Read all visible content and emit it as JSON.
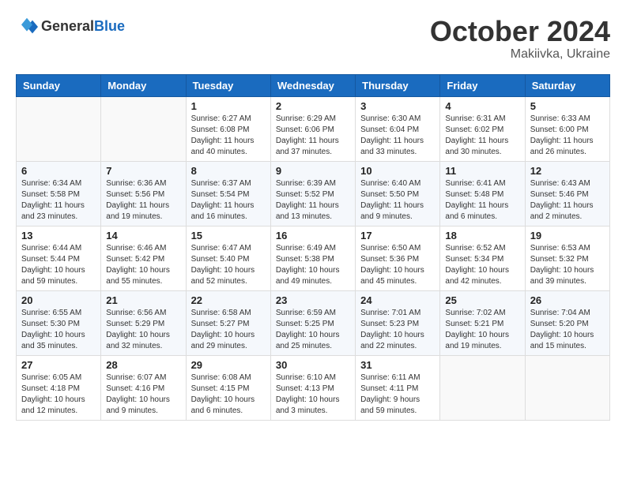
{
  "header": {
    "logo_general": "General",
    "logo_blue": "Blue",
    "month_title": "October 2024",
    "location": "Makiivka, Ukraine"
  },
  "columns": [
    "Sunday",
    "Monday",
    "Tuesday",
    "Wednesday",
    "Thursday",
    "Friday",
    "Saturday"
  ],
  "weeks": [
    [
      {
        "day": "",
        "content": ""
      },
      {
        "day": "",
        "content": ""
      },
      {
        "day": "1",
        "content": "Sunrise: 6:27 AM\nSunset: 6:08 PM\nDaylight: 11 hours and 40 minutes."
      },
      {
        "day": "2",
        "content": "Sunrise: 6:29 AM\nSunset: 6:06 PM\nDaylight: 11 hours and 37 minutes."
      },
      {
        "day": "3",
        "content": "Sunrise: 6:30 AM\nSunset: 6:04 PM\nDaylight: 11 hours and 33 minutes."
      },
      {
        "day": "4",
        "content": "Sunrise: 6:31 AM\nSunset: 6:02 PM\nDaylight: 11 hours and 30 minutes."
      },
      {
        "day": "5",
        "content": "Sunrise: 6:33 AM\nSunset: 6:00 PM\nDaylight: 11 hours and 26 minutes."
      }
    ],
    [
      {
        "day": "6",
        "content": "Sunrise: 6:34 AM\nSunset: 5:58 PM\nDaylight: 11 hours and 23 minutes."
      },
      {
        "day": "7",
        "content": "Sunrise: 6:36 AM\nSunset: 5:56 PM\nDaylight: 11 hours and 19 minutes."
      },
      {
        "day": "8",
        "content": "Sunrise: 6:37 AM\nSunset: 5:54 PM\nDaylight: 11 hours and 16 minutes."
      },
      {
        "day": "9",
        "content": "Sunrise: 6:39 AM\nSunset: 5:52 PM\nDaylight: 11 hours and 13 minutes."
      },
      {
        "day": "10",
        "content": "Sunrise: 6:40 AM\nSunset: 5:50 PM\nDaylight: 11 hours and 9 minutes."
      },
      {
        "day": "11",
        "content": "Sunrise: 6:41 AM\nSunset: 5:48 PM\nDaylight: 11 hours and 6 minutes."
      },
      {
        "day": "12",
        "content": "Sunrise: 6:43 AM\nSunset: 5:46 PM\nDaylight: 11 hours and 2 minutes."
      }
    ],
    [
      {
        "day": "13",
        "content": "Sunrise: 6:44 AM\nSunset: 5:44 PM\nDaylight: 10 hours and 59 minutes."
      },
      {
        "day": "14",
        "content": "Sunrise: 6:46 AM\nSunset: 5:42 PM\nDaylight: 10 hours and 55 minutes."
      },
      {
        "day": "15",
        "content": "Sunrise: 6:47 AM\nSunset: 5:40 PM\nDaylight: 10 hours and 52 minutes."
      },
      {
        "day": "16",
        "content": "Sunrise: 6:49 AM\nSunset: 5:38 PM\nDaylight: 10 hours and 49 minutes."
      },
      {
        "day": "17",
        "content": "Sunrise: 6:50 AM\nSunset: 5:36 PM\nDaylight: 10 hours and 45 minutes."
      },
      {
        "day": "18",
        "content": "Sunrise: 6:52 AM\nSunset: 5:34 PM\nDaylight: 10 hours and 42 minutes."
      },
      {
        "day": "19",
        "content": "Sunrise: 6:53 AM\nSunset: 5:32 PM\nDaylight: 10 hours and 39 minutes."
      }
    ],
    [
      {
        "day": "20",
        "content": "Sunrise: 6:55 AM\nSunset: 5:30 PM\nDaylight: 10 hours and 35 minutes."
      },
      {
        "day": "21",
        "content": "Sunrise: 6:56 AM\nSunset: 5:29 PM\nDaylight: 10 hours and 32 minutes."
      },
      {
        "day": "22",
        "content": "Sunrise: 6:58 AM\nSunset: 5:27 PM\nDaylight: 10 hours and 29 minutes."
      },
      {
        "day": "23",
        "content": "Sunrise: 6:59 AM\nSunset: 5:25 PM\nDaylight: 10 hours and 25 minutes."
      },
      {
        "day": "24",
        "content": "Sunrise: 7:01 AM\nSunset: 5:23 PM\nDaylight: 10 hours and 22 minutes."
      },
      {
        "day": "25",
        "content": "Sunrise: 7:02 AM\nSunset: 5:21 PM\nDaylight: 10 hours and 19 minutes."
      },
      {
        "day": "26",
        "content": "Sunrise: 7:04 AM\nSunset: 5:20 PM\nDaylight: 10 hours and 15 minutes."
      }
    ],
    [
      {
        "day": "27",
        "content": "Sunrise: 6:05 AM\nSunset: 4:18 PM\nDaylight: 10 hours and 12 minutes."
      },
      {
        "day": "28",
        "content": "Sunrise: 6:07 AM\nSunset: 4:16 PM\nDaylight: 10 hours and 9 minutes."
      },
      {
        "day": "29",
        "content": "Sunrise: 6:08 AM\nSunset: 4:15 PM\nDaylight: 10 hours and 6 minutes."
      },
      {
        "day": "30",
        "content": "Sunrise: 6:10 AM\nSunset: 4:13 PM\nDaylight: 10 hours and 3 minutes."
      },
      {
        "day": "31",
        "content": "Sunrise: 6:11 AM\nSunset: 4:11 PM\nDaylight: 9 hours and 59 minutes."
      },
      {
        "day": "",
        "content": ""
      },
      {
        "day": "",
        "content": ""
      }
    ]
  ]
}
